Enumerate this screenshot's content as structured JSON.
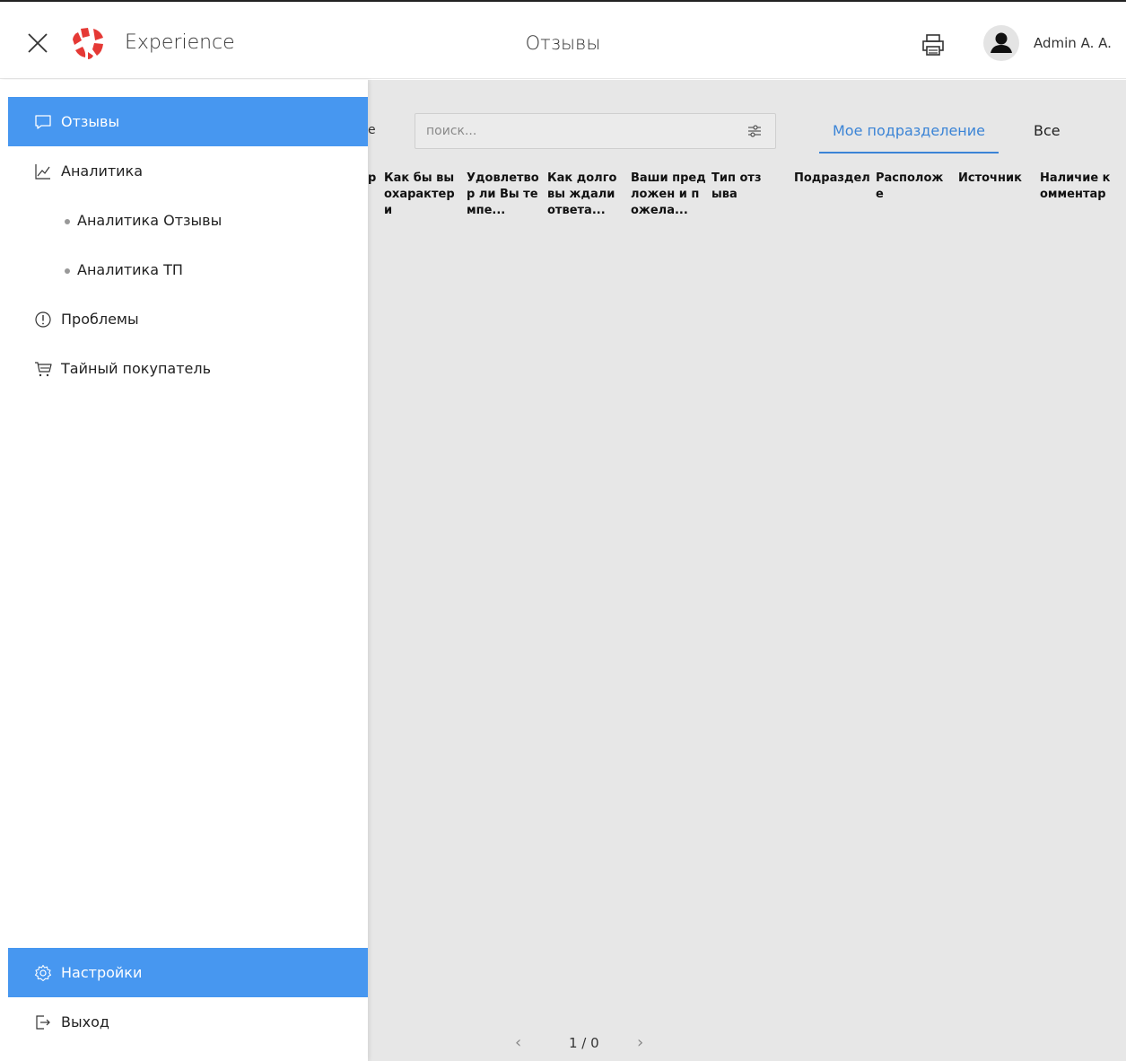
{
  "header": {
    "app_name": "Experience",
    "page_title": "Отзывы",
    "user_name": "Admin A. A.",
    "brand_color": "#e53935"
  },
  "sidebar": {
    "accent_color": "#4797f0",
    "items": [
      {
        "label": "Отзывы",
        "icon": "chat-icon",
        "active": true
      },
      {
        "label": "Аналитика",
        "icon": "chart-line-icon"
      },
      {
        "label": "Аналитика Отзывы",
        "sub": true
      },
      {
        "label": "Аналитика ТП",
        "sub": true
      },
      {
        "label": "Проблемы",
        "icon": "alert-circle-icon"
      },
      {
        "label": "Тайный покупатель",
        "icon": "cart-icon"
      }
    ],
    "bottom": [
      {
        "label": "Настройки",
        "icon": "gear-icon",
        "active": true
      },
      {
        "label": "Выход",
        "icon": "logout-icon"
      }
    ]
  },
  "main": {
    "cut_label": "е",
    "search": {
      "placeholder": "поиск...",
      "value": ""
    },
    "tabs": [
      {
        "label": "Мое подразделение",
        "active": true
      },
      {
        "label": "Все"
      }
    ],
    "columns": [
      "р",
      "Как бы вы охарактери",
      "Удовлетвор ли Вы темпе...",
      "Как долго вы ждали ответа...",
      "Ваши предложен и пожела...",
      "Тип отзыва",
      "Подраздел",
      "Расположе",
      "Источник",
      "Наличие комментар"
    ],
    "pagination": {
      "text": "1 / 0",
      "prev": "‹",
      "next": "›"
    }
  }
}
